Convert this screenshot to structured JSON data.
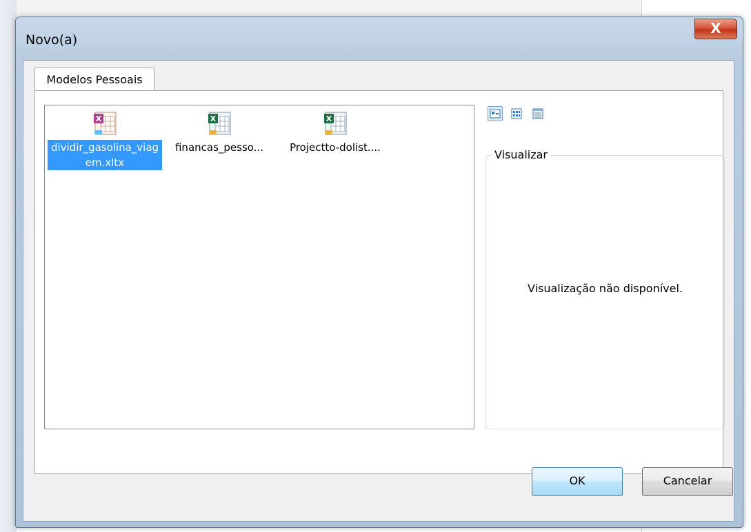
{
  "dialog": {
    "title": "Novo(a)",
    "close_label": "X"
  },
  "tab": {
    "label": "Modelos Pessoais"
  },
  "files": [
    {
      "label": "dividir_gasolina_viagem.xltx",
      "selected": true
    },
    {
      "label": "financas_pesso...",
      "selected": false
    },
    {
      "label": "Projectto-dolist....",
      "selected": false
    }
  ],
  "preview": {
    "label": "Visualizar",
    "message": "Visualização não disponível."
  },
  "buttons": {
    "ok": "OK",
    "cancel": "Cancelar"
  },
  "view_modes": [
    "large-icons",
    "list",
    "details"
  ],
  "colors": {
    "selection": "#3399ff",
    "close_button": "#c2351a"
  }
}
